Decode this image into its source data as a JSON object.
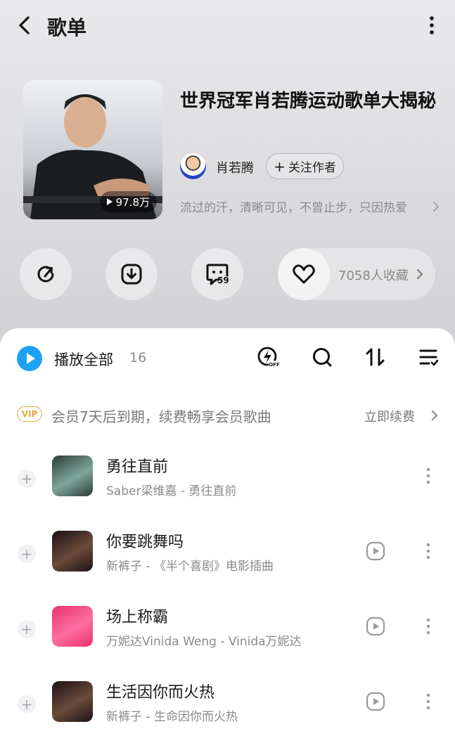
{
  "header": {
    "title": "歌单",
    "back_icon": "back-icon",
    "more_icon": "more-vertical-icon"
  },
  "playlist": {
    "title": "世界冠军肖若腾运动歌单大揭秘",
    "play_count": "97.8万",
    "author": {
      "name": "肖若腾",
      "follow_label": "关注作者"
    },
    "description": "流过的汗，清晰可见，不曾止步，只因热爱"
  },
  "actions": {
    "share_icon": "share-icon",
    "download_icon": "download-icon",
    "comment_icon": "comment-icon",
    "comment_count": "59",
    "favorite_icon": "heart-icon",
    "favorite_text": "7058人收藏"
  },
  "list_header": {
    "play_all_label": "播放全部",
    "song_count": "16",
    "tools": [
      "quality-off-icon",
      "search-icon",
      "sort-icon",
      "multi-select-icon"
    ]
  },
  "vip_banner": {
    "badge": "VIP",
    "text": "会员7天后到期，续费畅享会员歌曲",
    "action_label": "立即续费"
  },
  "songs": [
    {
      "title": "勇往直前",
      "subtitle": "Saber梁维嘉 - 勇往直前",
      "has_mv": false,
      "cover_colors": [
        "#2a3b36",
        "#7fa79c"
      ]
    },
    {
      "title": "你要跳舞吗",
      "subtitle": "新裤子 - 《半个喜剧》电影插曲",
      "has_mv": true,
      "cover_colors": [
        "#1b1216",
        "#6b4a3a"
      ]
    },
    {
      "title": "场上称霸",
      "subtitle": "万妮达Vinida Weng - Vinida万妮达",
      "has_mv": true,
      "cover_colors": [
        "#e8326e",
        "#ff6ea1"
      ]
    },
    {
      "title": "生活因你而火热",
      "subtitle": "新裤子 - 生命因你而火热",
      "has_mv": true,
      "cover_colors": [
        "#1b1216",
        "#6b4a3a"
      ]
    }
  ],
  "colors": {
    "accent_blue": "#1da1f2",
    "vip_gold": "#e0a942",
    "muted_text": "#8a8a8e"
  }
}
